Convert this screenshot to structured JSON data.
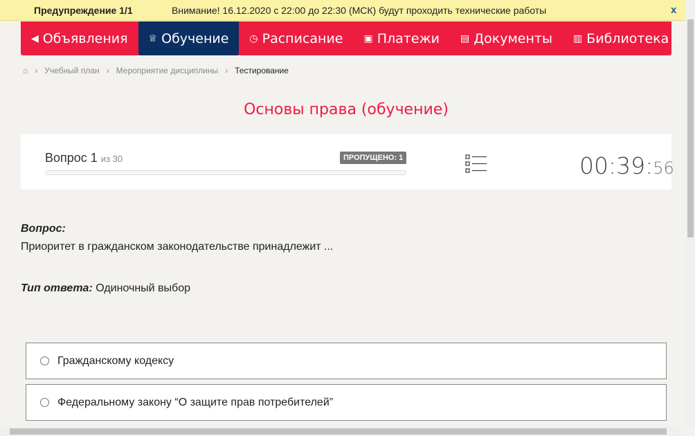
{
  "warning": {
    "title": "Предупреждение 1/1",
    "message": "Внимание! 16.12.2020 с 22:00 до 22:30 (МСК) будут проходить технические работы",
    "close": "x"
  },
  "nav": [
    {
      "icon": "megaphone-icon",
      "glyph": "📢",
      "label": "Объявления"
    },
    {
      "icon": "graduation-cap-icon",
      "glyph": "🎓",
      "label": "Обучение",
      "active": true
    },
    {
      "icon": "clock-icon",
      "glyph": "◷",
      "label": "Расписание"
    },
    {
      "icon": "payment-icon",
      "glyph": "▣",
      "label": "Платежи"
    },
    {
      "icon": "document-icon",
      "glyph": "🗎",
      "label": "Документы"
    },
    {
      "icon": "book-icon",
      "glyph": "📖",
      "label": "Библиотека",
      "chevron": "⌄"
    }
  ],
  "breadcrumbs": [
    "Учебный план",
    "Мероприятие дисциплины",
    "Тестирование"
  ],
  "page_title": "Основы права (обучение)",
  "progress": {
    "question_label": "Вопрос 1",
    "of": "из 30",
    "skipped": "ПРОПУЩЕНО: 1",
    "fraction": 0,
    "timer_main": "00:39:",
    "timer_sec": "56"
  },
  "question": {
    "label": "Вопрос:",
    "text": "Приоритет в гражданском законодательстве принадлежит ...",
    "type_label": "Тип ответа:",
    "type": "Одиночный выбор"
  },
  "options": [
    "Гражданскому кодексу",
    "Федеральному закону “О защите прав потребителей”"
  ]
}
